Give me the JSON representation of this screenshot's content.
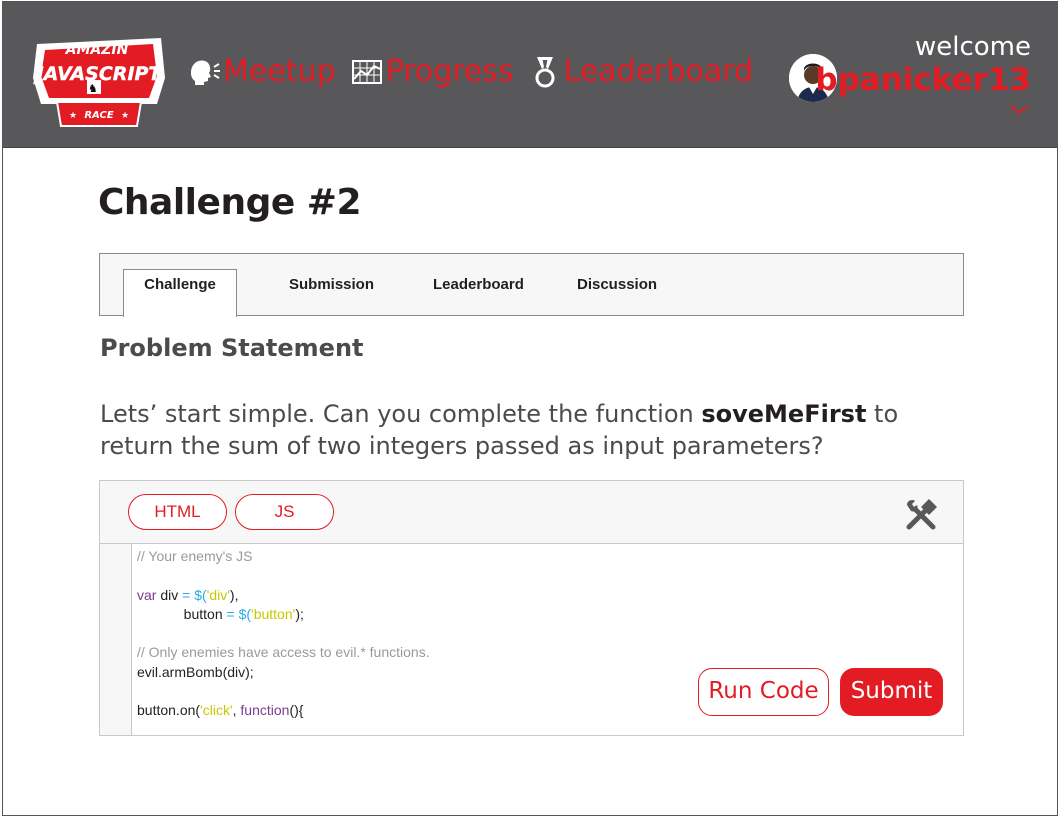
{
  "logo": {
    "line1": "AMAZIN",
    "line2": "JAVASCRIPT",
    "line3": "RACE"
  },
  "nav": {
    "items": [
      {
        "label": "Meetup",
        "icon": "speaking-head-icon"
      },
      {
        "label": "Progress",
        "icon": "chart-icon"
      },
      {
        "label": "Leaderboard",
        "icon": "medal-icon"
      }
    ]
  },
  "user": {
    "welcome": "welcome",
    "username": "bpanicker13"
  },
  "page": {
    "title": "Challenge #2"
  },
  "tabs": [
    "Challenge",
    "Submission",
    "Leaderboard",
    "Discussion"
  ],
  "problem": {
    "heading": "Problem Statement",
    "text_before": "Lets’ start simple. Can you complete the function ",
    "function_name": "soveMeFirst",
    "text_after": " to return the sum of two integers passed as input parameters?"
  },
  "editor": {
    "lang_tabs": [
      "HTML",
      "JS"
    ],
    "code": {
      "comment1": "// Your enemy's JS",
      "comment2": "// Only enemies have access to evil.* functions.",
      "line_arm": "evil.armBomb(div);"
    },
    "run_label": "Run Code",
    "submit_label": "Submit"
  },
  "colors": {
    "accent": "#e31b23",
    "header_bg": "#58585a"
  }
}
